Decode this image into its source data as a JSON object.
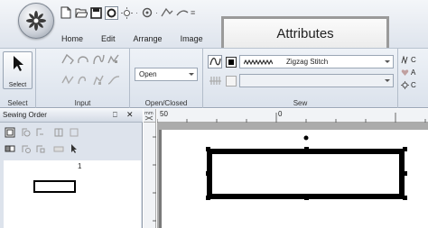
{
  "quick_access": {
    "icons": [
      "new-file-icon",
      "open-folder-icon",
      "save-icon",
      "record-icon",
      "undo-icon",
      "redo-icon",
      "transfer-icon",
      "customize-icon"
    ]
  },
  "ribbon_tabs": [
    "Home",
    "Edit",
    "Arrange",
    "Image"
  ],
  "callout_label": "Attributes",
  "groups": {
    "select": {
      "button_label": "Select",
      "label": "Select"
    },
    "input": {
      "label": "Input"
    },
    "open_closed": {
      "value": "Open",
      "label": "Open/Closed"
    },
    "sew": {
      "stitch_type": "Zigzag Stitch",
      "label": "Sew"
    }
  },
  "right_partial": [
    "C",
    "A",
    "C"
  ],
  "sewing_order": {
    "title": "Sewing Order",
    "pin": "⎕",
    "close": "✕",
    "thumbnail_number": "1"
  },
  "ruler": {
    "h_marks": [
      "50",
      "0"
    ]
  }
}
